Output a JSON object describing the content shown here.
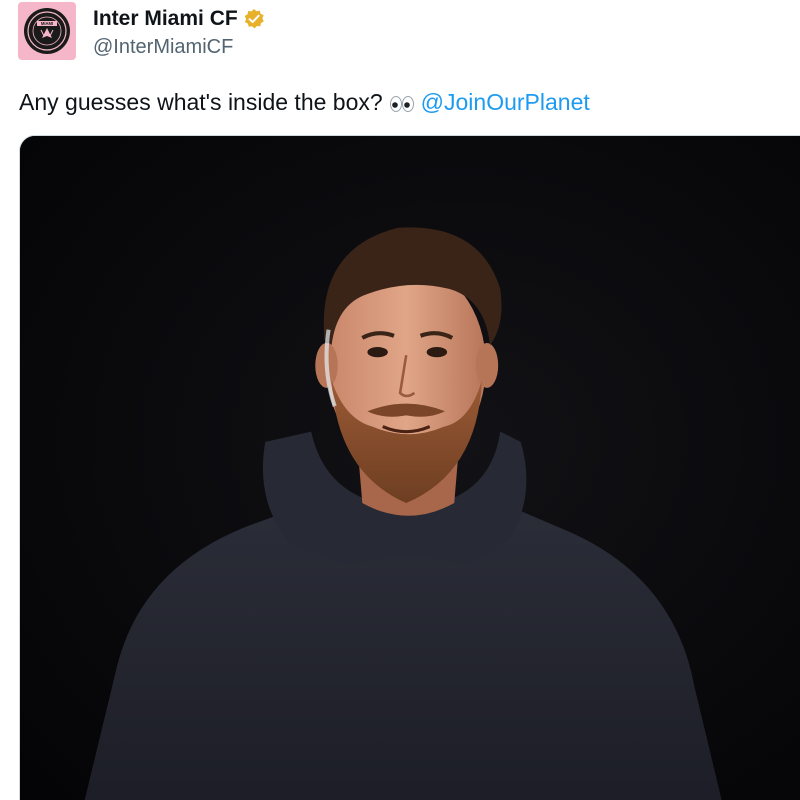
{
  "account": {
    "display_name": "Inter Miami CF",
    "handle": "@InterMiamiCF",
    "verified_badge": "gold-verified-icon",
    "avatar_icon": "inter-miami-crest-icon",
    "avatar_text": "MIAMI"
  },
  "tweet": {
    "text": "Any guesses what's inside the box?",
    "emoji": "eyes-emoji",
    "mention": "@JoinOurPlanet"
  },
  "media": {
    "type": "photo",
    "description_icon": "photo-portrait"
  },
  "colors": {
    "name": "#0f1419",
    "handle": "#536471",
    "link": "#1d9bf0",
    "avatar_bg": "#f4b6c8",
    "badge": "#e8b12c"
  }
}
